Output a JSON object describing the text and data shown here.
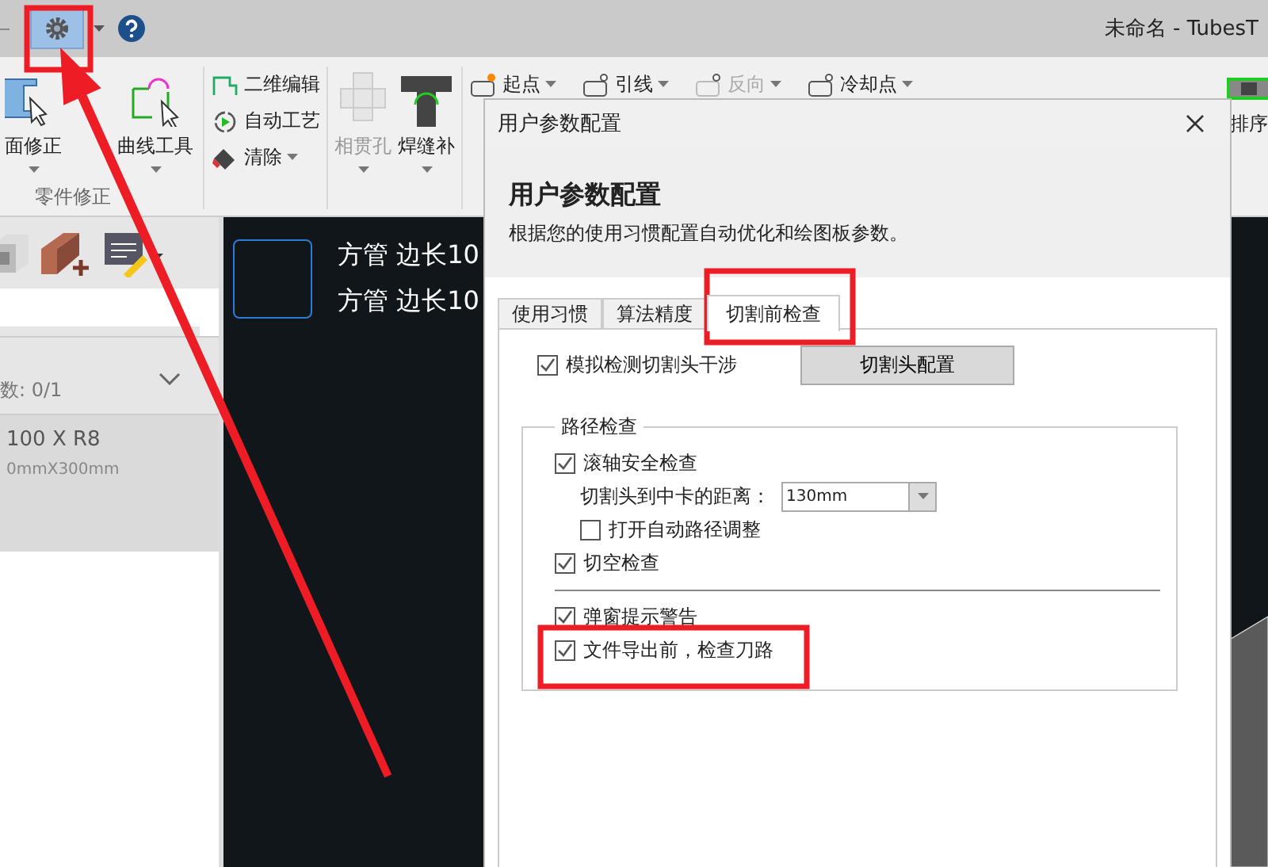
{
  "title_bar": {
    "title": "未命名 - TubesT"
  },
  "ribbon": {
    "columns": [
      {
        "kind": "large",
        "label": "面修正",
        "disabled": false,
        "dropdown": true
      },
      {
        "kind": "large",
        "label": "曲线工具",
        "disabled": false,
        "dropdown": true
      },
      {
        "kind": "separator"
      },
      {
        "kind": "stack",
        "items": [
          {
            "label": "二维编辑",
            "disabled": false,
            "dropdown": false
          },
          {
            "label": "自动工艺",
            "disabled": false,
            "dropdown": false
          },
          {
            "label": "清除",
            "disabled": false,
            "dropdown": true
          }
        ]
      },
      {
        "kind": "separator"
      },
      {
        "kind": "large",
        "label": "相贯孔",
        "disabled": true,
        "dropdown": true
      },
      {
        "kind": "large",
        "label": "焊缝补",
        "disabled": false,
        "dropdown": true
      },
      {
        "kind": "separator"
      },
      {
        "kind": "stack",
        "items": [
          {
            "label": "起点",
            "disabled": false,
            "dropdown": true
          }
        ]
      },
      {
        "kind": "stack",
        "items": [
          {
            "label": "引线",
            "disabled": false,
            "dropdown": true
          }
        ]
      },
      {
        "kind": "stack",
        "items": [
          {
            "label": "反向",
            "disabled": true,
            "dropdown": true
          }
        ]
      },
      {
        "kind": "stack",
        "items": [
          {
            "label": "冷却点",
            "disabled": false,
            "dropdown": true
          }
        ]
      }
    ],
    "group_label": "零件修正",
    "right_tool": {
      "label": "排序"
    }
  },
  "left_panel": {
    "count_label": "数: 0/1",
    "part": {
      "name": "100 X R8",
      "size": "0mmX300mm"
    }
  },
  "canvas": {
    "labels": [
      "方管 边长10",
      "方管 边长10"
    ]
  },
  "dialog": {
    "window_title": "用户参数配置",
    "heading": "用户参数配置",
    "description": "根据您的使用习惯配置自动优化和绘图板参数。",
    "tabs": [
      {
        "label": "使用习惯",
        "selected": false
      },
      {
        "label": "算法精度",
        "selected": false
      },
      {
        "label": "切割前检查",
        "selected": true
      }
    ],
    "interference": {
      "label": "模拟检测切割头干涉",
      "checked": true
    },
    "config_button": "切割头配置",
    "path_group": {
      "title": "路径检查",
      "items": [
        {
          "kind": "checkbox",
          "label": "滚轴安全检查",
          "checked": true,
          "indent": false
        },
        {
          "kind": "combo",
          "label": "切割头到中卡的距离：",
          "value": "130mm"
        },
        {
          "kind": "checkbox",
          "label": "打开自动路径调整",
          "checked": false,
          "indent": true
        },
        {
          "kind": "checkbox",
          "label": "切空检查",
          "checked": true,
          "indent": false
        },
        {
          "kind": "separator"
        },
        {
          "kind": "checkbox",
          "label": "弹窗提示警告",
          "checked": true,
          "indent": false
        },
        {
          "kind": "checkbox",
          "label": "文件导出前，检查刀路",
          "checked": true,
          "indent": false
        }
      ]
    }
  }
}
